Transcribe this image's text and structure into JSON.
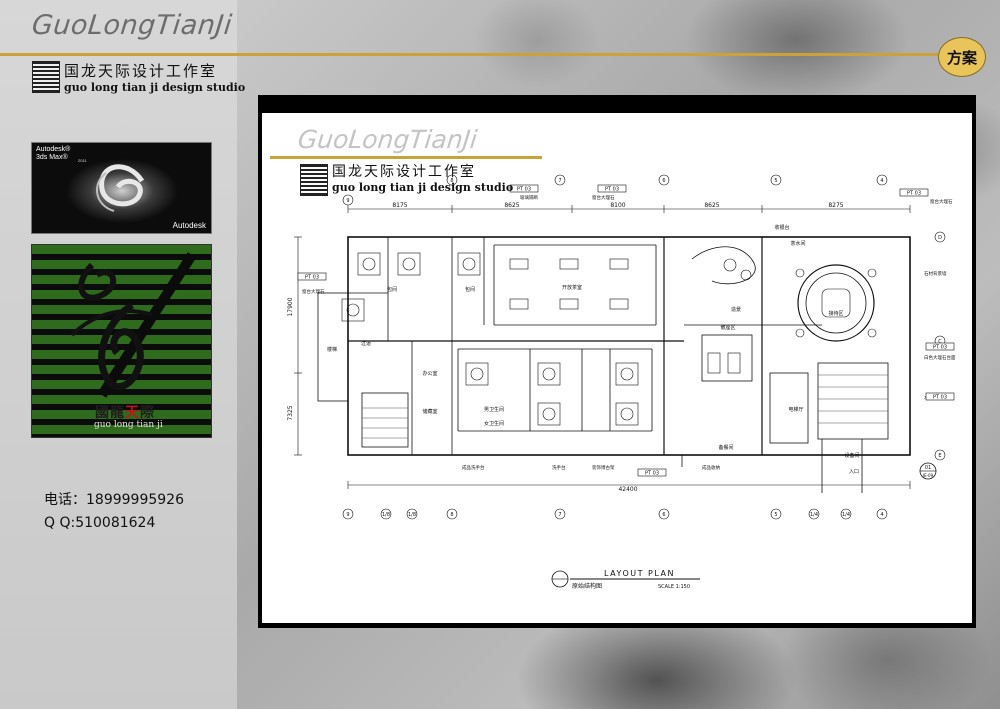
{
  "header": {
    "brand_script": "GuoLongTianJi",
    "studio_cn": "国龙天际设计工作室",
    "studio_en": "guo long tian ji design studio",
    "section_badge": "方案",
    "accent_color": "#c9a23a"
  },
  "sidebar": {
    "software_box": {
      "name_line1": "Autodesk®",
      "name_line2": "3ds Max®",
      "version": "2011",
      "brand": "Autodesk"
    },
    "logo_box": {
      "name_cn_1": "國龍",
      "name_cn_2": "天",
      "name_cn_3": "際",
      "name_en": "guo long tian ji"
    },
    "contact": {
      "phone": "电话：18999995926",
      "qq": "Q  Q:510081624"
    }
  },
  "drawing": {
    "brand_script": "GuoLongTianJi",
    "studio_cn": "国龙天际设计工作室",
    "studio_en": "guo long tian ji design studio",
    "plan_title": "LAYOUT PLAN",
    "plan_subtitle": "原始结构图",
    "scale": "SCALE 1:150",
    "dim_overall": "42400",
    "dim_top_1": "8175",
    "dim_top_2": "8625",
    "dim_top_3": "8100",
    "dim_top_4": "8625",
    "dim_top_5": "8275",
    "dim_left_1": "17900",
    "dim_left_2": "7325",
    "grid_top": [
      "9",
      "8",
      "7",
      "6",
      "5",
      "4"
    ],
    "grid_bottom": [
      "9",
      "1/8",
      "1/8",
      "8",
      "7",
      "6",
      "5",
      "1/4",
      "1/4",
      "4"
    ],
    "grid_right": [
      "D",
      "C",
      "E"
    ],
    "tags": {
      "pt03": "PT 03",
      "window_stone": "窗台大理石",
      "sheet_no": "01",
      "sheet_ref": "IE-09"
    },
    "room_labels": {
      "vip_room": "包间",
      "corridor": "过道",
      "open_card": "开放茶室",
      "waiting": "接待区",
      "cashier": "收银台",
      "landscape": "造景",
      "tea_room": "茶水间",
      "hall": "散座区",
      "restroom_m": "男卫生间",
      "restroom_f": "女卫生间",
      "elevator": "电梯厅",
      "stairs": "楼梯",
      "office": "办公室",
      "storage": "储藏室",
      "equipment": "设备间",
      "entrance": "入口",
      "pantry": "备餐间",
      "finished_storage": "成品收纳",
      "glass_partition": "玻璃隔断",
      "washbasin": "成品洗手台",
      "hand_sink": "洗手台",
      "decor_shelf": "装饰博古架",
      "white_marble": "白色大理石台面",
      "stone_wall": "石材背景墙",
      "flooring": "木地板铺装"
    }
  }
}
